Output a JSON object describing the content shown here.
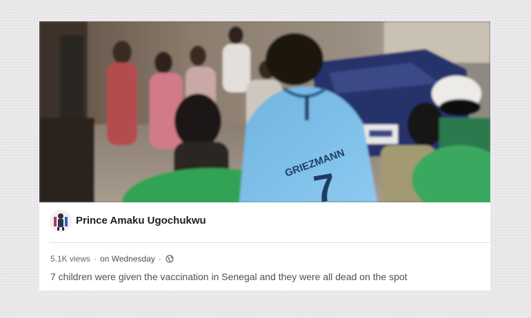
{
  "post": {
    "author": "Prince Amaku Ugochukwu",
    "views": "5.1K views",
    "separator": "·",
    "posted": "on Wednesday",
    "caption": "7 children were given the vaccination in Senegal and they were all dead on the spot"
  },
  "video_frame": {
    "jersey_name": "GRIEZMANN",
    "jersey_number": "7"
  },
  "icons": {
    "audience": "globe-icon",
    "avatar": "profile-photo"
  },
  "colors": {
    "page_background": "#eceaed",
    "card_background": "#ffffff",
    "author_text": "#1c1e21",
    "meta_text": "#606770",
    "caption_text": "#4b4f56",
    "divider": "#dddfe2"
  }
}
